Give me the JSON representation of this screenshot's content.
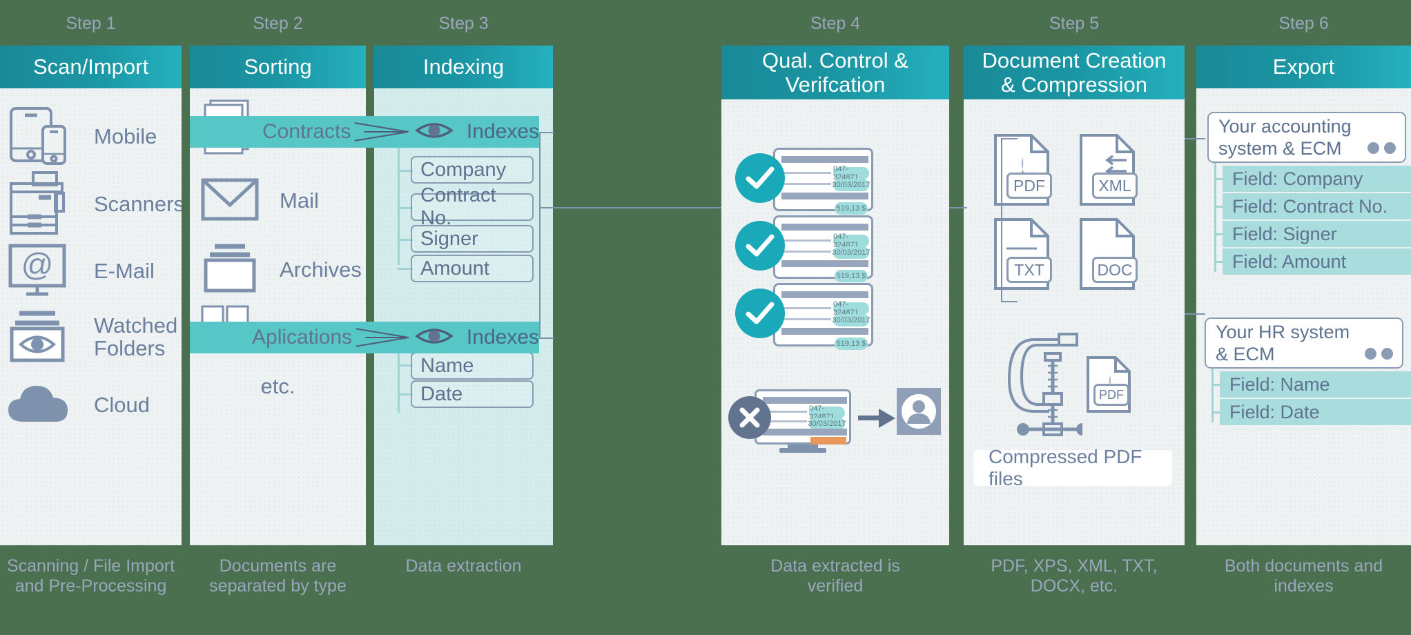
{
  "theme": {
    "background": "#4a7050",
    "header_teal": "#1b96a4",
    "panel": "#eef2f3",
    "panel_teal": "#d4ecec",
    "highlight": "#56c6c6",
    "ink": "#6b7f9e",
    "step_label": "#9aa6bc",
    "check": "#1aa9b8",
    "field_bar": "#a9dcdc"
  },
  "steps": [
    {
      "step": "Step 1",
      "title": "Scan/Import",
      "caption_line1": "Scanning / File Import",
      "caption_line2": "and Pre-Processing"
    },
    {
      "step": "Step 2",
      "title": "Sorting",
      "caption_line1": "Documents are",
      "caption_line2": "separated by type"
    },
    {
      "step": "Step 3",
      "title": "Indexing",
      "caption_line1": "Data extraction",
      "caption_line2": ""
    },
    {
      "step": "Step 4",
      "title_line1": "Qual. Control &",
      "title_line2": "Verifcation",
      "caption_line1": "Data extracted is",
      "caption_line2": "verified"
    },
    {
      "step": "Step 5",
      "title_line1": "Document Creation",
      "title_line2": "& Compression",
      "caption_line1": "PDF, XPS, XML, TXT,",
      "caption_line2": "DOCX, etc."
    },
    {
      "step": "Step 6",
      "title": "Export",
      "caption_line1": "Both documents and",
      "caption_line2": "indexes"
    }
  ],
  "scan_import": {
    "sources": [
      {
        "label": "Mobile",
        "icon": "mobile-devices-icon"
      },
      {
        "label": "Scanners",
        "icon": "scanner-icon"
      },
      {
        "label": "E-Mail",
        "icon": "email-monitor-icon"
      },
      {
        "label_line1": "Watched",
        "label_line2": "Folders",
        "icon": "watched-folder-eye-icon"
      },
      {
        "label": "Cloud",
        "icon": "cloud-icon"
      }
    ]
  },
  "sorting": {
    "types": [
      {
        "label": "Contracts",
        "icon": "documents-stack-icon",
        "highlighted": true
      },
      {
        "label": "Mail",
        "icon": "envelope-icon",
        "highlighted": false
      },
      {
        "label": "Archives",
        "icon": "archive-box-icon",
        "highlighted": false
      },
      {
        "label": "Aplications",
        "icon": "application-grid-icon",
        "highlighted": true
      }
    ],
    "etc": "etc."
  },
  "indexing": {
    "groups": [
      {
        "header": "Indexes",
        "icon": "eye-icon",
        "fields": [
          "Company",
          "Contract No.",
          "Signer",
          "Amount"
        ]
      },
      {
        "header": "Indexes",
        "icon": "eye-icon",
        "fields": [
          "Name",
          "Date"
        ]
      }
    ]
  },
  "quality_control": {
    "approved_documents": [
      {
        "status": "approved",
        "icon": "check-circle-icon",
        "ref_no": "047-324871",
        "date": "30/03/2017",
        "amount": "519,13 $"
      },
      {
        "status": "approved",
        "icon": "check-circle-icon",
        "ref_no": "047-324871",
        "date": "30/03/2017",
        "amount": "519,13 $"
      },
      {
        "status": "approved",
        "icon": "check-circle-icon",
        "ref_no": "047-324871",
        "date": "30/03/2017",
        "amount": "519,13 $"
      }
    ],
    "rejected_document": {
      "status": "rejected",
      "icon": "x-circle-icon",
      "ref_no": "047-324871",
      "date": "30/03/2017",
      "arrow_icon": "arrow-right-icon",
      "operator_icon": "user-avatar-icon"
    }
  },
  "document_creation": {
    "formats": [
      {
        "label": "PDF",
        "icon": "pdf-file-icon"
      },
      {
        "label": "XML",
        "icon": "xml-file-icon"
      },
      {
        "label": "TXT",
        "icon": "txt-file-icon"
      },
      {
        "label": "DOC",
        "icon": "doc-file-icon"
      }
    ],
    "compression": {
      "clamp_icon": "clamp-icon",
      "file_label": "PDF",
      "note": "Compressed PDF files"
    }
  },
  "export": {
    "targets": [
      {
        "title_line1": "Your accounting",
        "title_line2": "system & ECM",
        "dots_icon": "two-dots-icon",
        "fields": [
          "Field: Company",
          "Field: Contract No.",
          "Field: Signer",
          "Field: Amount"
        ]
      },
      {
        "title_line1": "Your HR system",
        "title_line2": "& ECM",
        "dots_icon": "two-dots-icon",
        "fields": [
          "Field: Name",
          "Field: Date"
        ]
      }
    ]
  }
}
